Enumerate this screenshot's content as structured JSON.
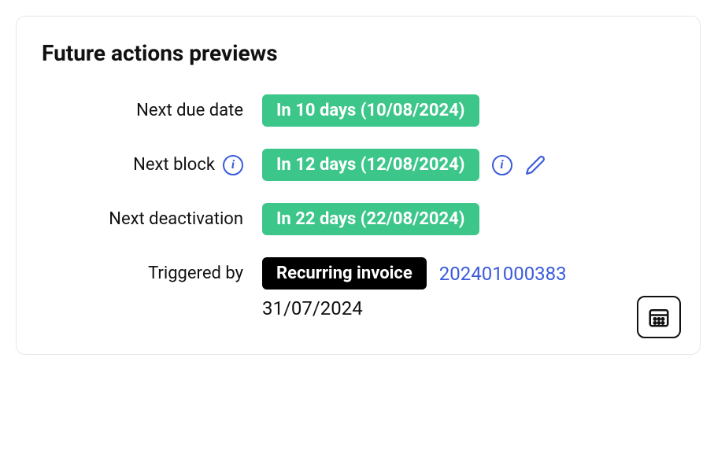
{
  "title": "Future actions previews",
  "rows": {
    "next_due_date": {
      "label": "Next due date",
      "badge": "In 10 days (10/08/2024)"
    },
    "next_block": {
      "label": "Next block",
      "badge": "In 12 days (12/08/2024)"
    },
    "next_deactivation": {
      "label": "Next deactivation",
      "badge": "In 22 days (22/08/2024)"
    },
    "triggered_by": {
      "label": "Triggered by",
      "badge": "Recurring invoice",
      "link": "202401000383",
      "date": "31/07/2024"
    }
  },
  "colors": {
    "accent": "#3b5bdb",
    "badge_green": "#3cc68a",
    "badge_black": "#000000"
  }
}
